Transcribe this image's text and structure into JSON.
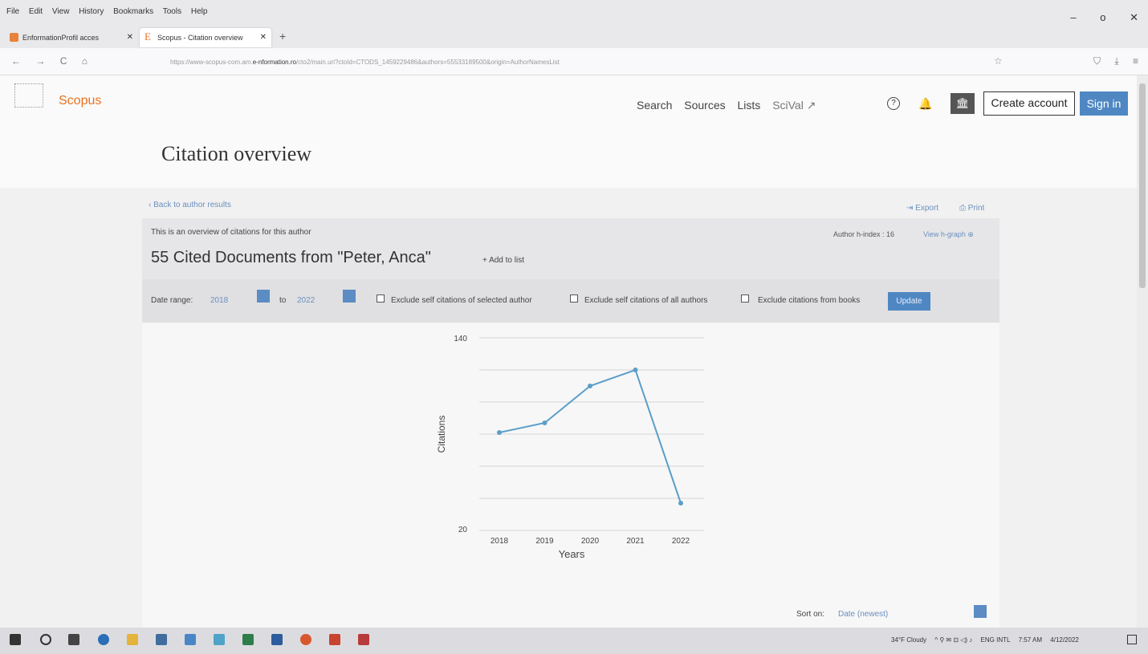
{
  "browser": {
    "menu": [
      "File",
      "Edit",
      "View",
      "History",
      "Bookmarks",
      "Tools",
      "Help"
    ],
    "window_controls": [
      "–",
      "o",
      "✕"
    ],
    "tabs": [
      {
        "label": "EnformationProfil acces",
        "close": "✕"
      },
      {
        "label": "Scopus - Citation overview",
        "close": "✕"
      }
    ],
    "new_tab": "+",
    "nav_buttons": [
      "←",
      "→",
      "C",
      "⌂"
    ],
    "url_prefix": "https://www-scopus-com.am.",
    "url_domain": "e-nformation.ro",
    "url_suffix": "/cto2/main.uri?ctoId=CTODS_1459229486&authors=55533189500&origin=AuthorNamesList",
    "star": "☆",
    "right_icons": [
      "⛉",
      "⤓",
      "≡"
    ]
  },
  "header": {
    "brand": "Scopus",
    "nav": [
      "Search",
      "Sources",
      "Lists"
    ],
    "scival": "SciVal ↗",
    "help_glyph": "?",
    "bell_glyph": "🔔",
    "inst_glyph": "🏛",
    "create_account": "Create account",
    "sign_in": "Sign in"
  },
  "page": {
    "title": "Citation overview",
    "back": "‹ Back to author results",
    "export": "⇥ Export",
    "print": "⎙ Print",
    "overview_note": "This is an overview of citations for this author",
    "hindex": "Author h-index : 16",
    "hgraph": "View h-graph ⊕",
    "heading": "55 Cited Documents from  \"Peter, Anca\"",
    "add_to_list": "+ Add to list",
    "date_range_label": "Date range:",
    "date_from": "2018",
    "to_label": "to",
    "date_to": "2022",
    "exclude_selected": "Exclude self citations of selected author",
    "exclude_all": "Exclude self citations of all authors",
    "exclude_books": "Exclude citations from books",
    "update": "Update",
    "sort_label": "Sort on:",
    "sort_value": "Date (newest)"
  },
  "chart_data": {
    "type": "line",
    "x": [
      "2018",
      "2019",
      "2020",
      "2021",
      "2022"
    ],
    "series": [
      {
        "values": [
          81,
          87,
          110,
          120,
          37
        ]
      }
    ],
    "xlabel": "Years",
    "ylabel": "Citations",
    "ylim": [
      20,
      140
    ],
    "ytick_labels": [
      "140",
      "20"
    ],
    "grid": true,
    "color": "#5b9ec9"
  },
  "taskbar": {
    "weather": "34°F Cloudy",
    "tray_glyphs": "^ ⚲ ✉ ⊡ ◁) ♪",
    "lang": "ENG INTL",
    "time": "7:57 AM",
    "date": "4/12/2022"
  }
}
